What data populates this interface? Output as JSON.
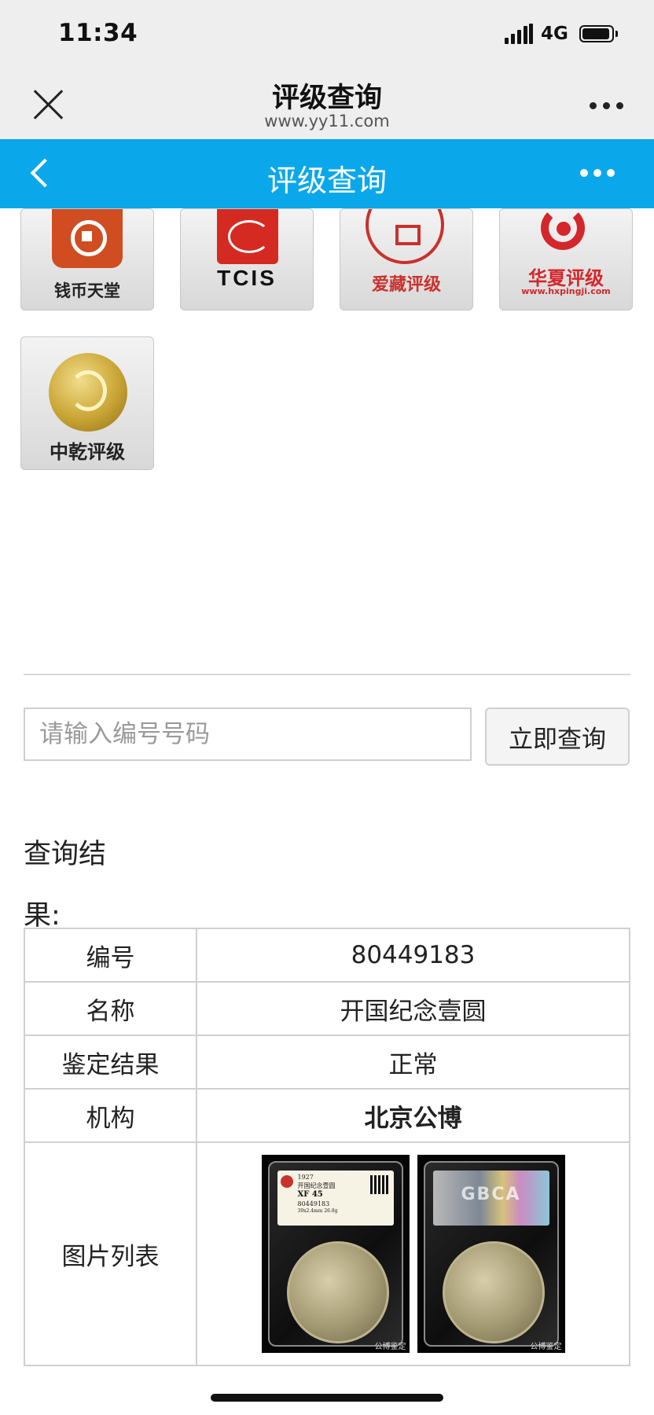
{
  "status_bar": {
    "time": "11:34",
    "network": "4G"
  },
  "browser": {
    "title": "评级查询",
    "url": "www.yy11.com"
  },
  "app_bar": {
    "title": "评级查询"
  },
  "graders": [
    {
      "label": "钱币天堂",
      "mark": "TCIS",
      "color": "#cf4d21"
    },
    {
      "label": "爱藏评级",
      "color": "#c9312c"
    },
    {
      "label": "华夏评级",
      "sub": "www.hxpingji.com",
      "color": "#d3272b"
    },
    {
      "label": "中乾评级",
      "color": "#b8962a"
    }
  ],
  "search": {
    "placeholder": "请输入编号号码",
    "button": "立即查询"
  },
  "result": {
    "label": "查询结果:",
    "rows": [
      {
        "key": "编号",
        "value": "80449183"
      },
      {
        "key": "名称",
        "value": "开国纪念壹圆"
      },
      {
        "key": "鉴定结果",
        "value": "正常"
      },
      {
        "key": "机构",
        "value": "北京公博"
      },
      {
        "key": "图片列表"
      }
    ],
    "photos": {
      "front": {
        "year": "1927",
        "name": "开国纪念壹圆",
        "grade": "XF 45",
        "serial": "80449183",
        "spec": "39x2.4mm 26.8g",
        "watermark": "公博鉴定"
      },
      "back": {
        "brand": "GBCA",
        "watermark": "公博鉴定"
      }
    }
  }
}
